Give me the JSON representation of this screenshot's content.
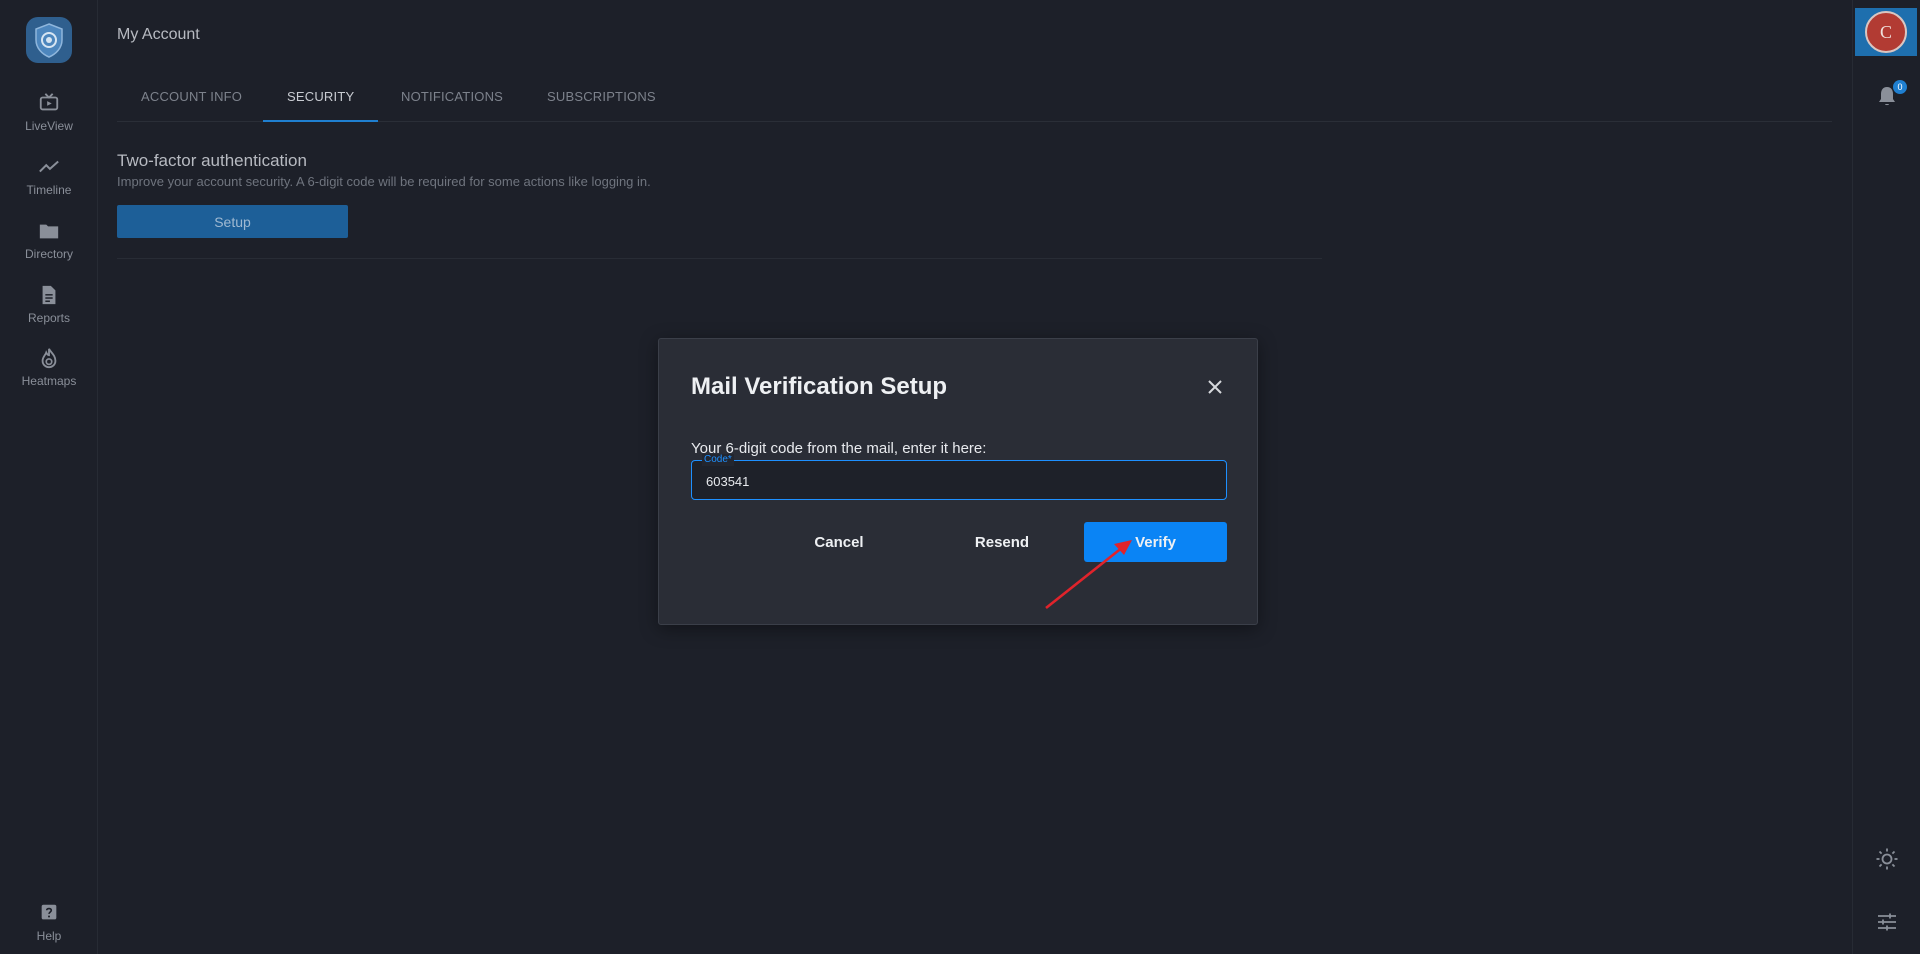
{
  "left_nav": {
    "items": [
      {
        "label": "LiveView",
        "icon": "tv-play-icon"
      },
      {
        "label": "Timeline",
        "icon": "trend-line-icon"
      },
      {
        "label": "Directory",
        "icon": "folder-icon"
      },
      {
        "label": "Reports",
        "icon": "document-icon"
      },
      {
        "label": "Heatmaps",
        "icon": "flame-icon"
      }
    ],
    "help": {
      "label": "Help",
      "icon": "help-icon"
    }
  },
  "header": {
    "title": "My Account"
  },
  "tabs": [
    {
      "label": "ACCOUNT INFO",
      "active": false
    },
    {
      "label": "SECURITY",
      "active": true
    },
    {
      "label": "NOTIFICATIONS",
      "active": false
    },
    {
      "label": "SUBSCRIPTIONS",
      "active": false
    }
  ],
  "security": {
    "title": "Two-factor authentication",
    "description": "Improve your account security. A 6-digit code will be required for some actions like logging in.",
    "setup_label": "Setup"
  },
  "right_bar": {
    "avatar_initial": "C",
    "notification_count": "0"
  },
  "modal": {
    "title": "Mail Verification Setup",
    "prompt": "Your 6-digit code from the mail, enter it here:",
    "code_label": "Code*",
    "code_value": "603541",
    "cancel_label": "Cancel",
    "resend_label": "Resend",
    "verify_label": "Verify"
  },
  "colors": {
    "background": "#1d2029",
    "accent": "#0a84f5",
    "modal_bg": "#2a2d36",
    "annotation_arrow": "#e0232b"
  }
}
